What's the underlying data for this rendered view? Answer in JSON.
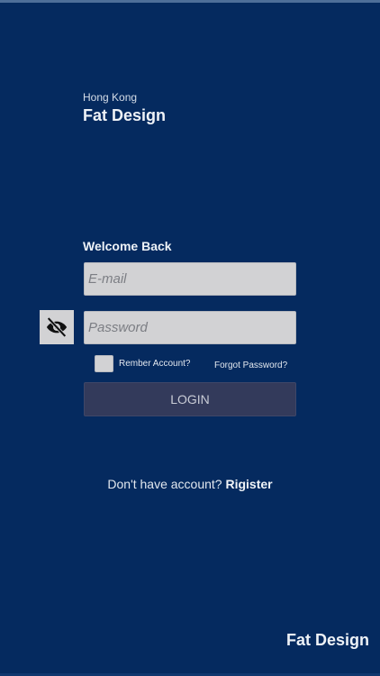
{
  "brand": {
    "subtitle": "Hong Kong",
    "title": "Fat Design"
  },
  "login": {
    "heading": "Welcome Back",
    "email_placeholder": "E-mail",
    "password_placeholder": "Password",
    "remember_label": "Rember Account?",
    "forgot_label": "Forgot Password?",
    "login_label": "LOGIN"
  },
  "register": {
    "prompt": "Don't have account?",
    "link_label": "Rigister"
  },
  "footer": {
    "brand": "Fat Design"
  },
  "icons": {
    "password_toggle": "eye-off-icon"
  },
  "colors": {
    "background": "#052a5f",
    "field": "#d2d2d4",
    "button": "#333a5b"
  }
}
